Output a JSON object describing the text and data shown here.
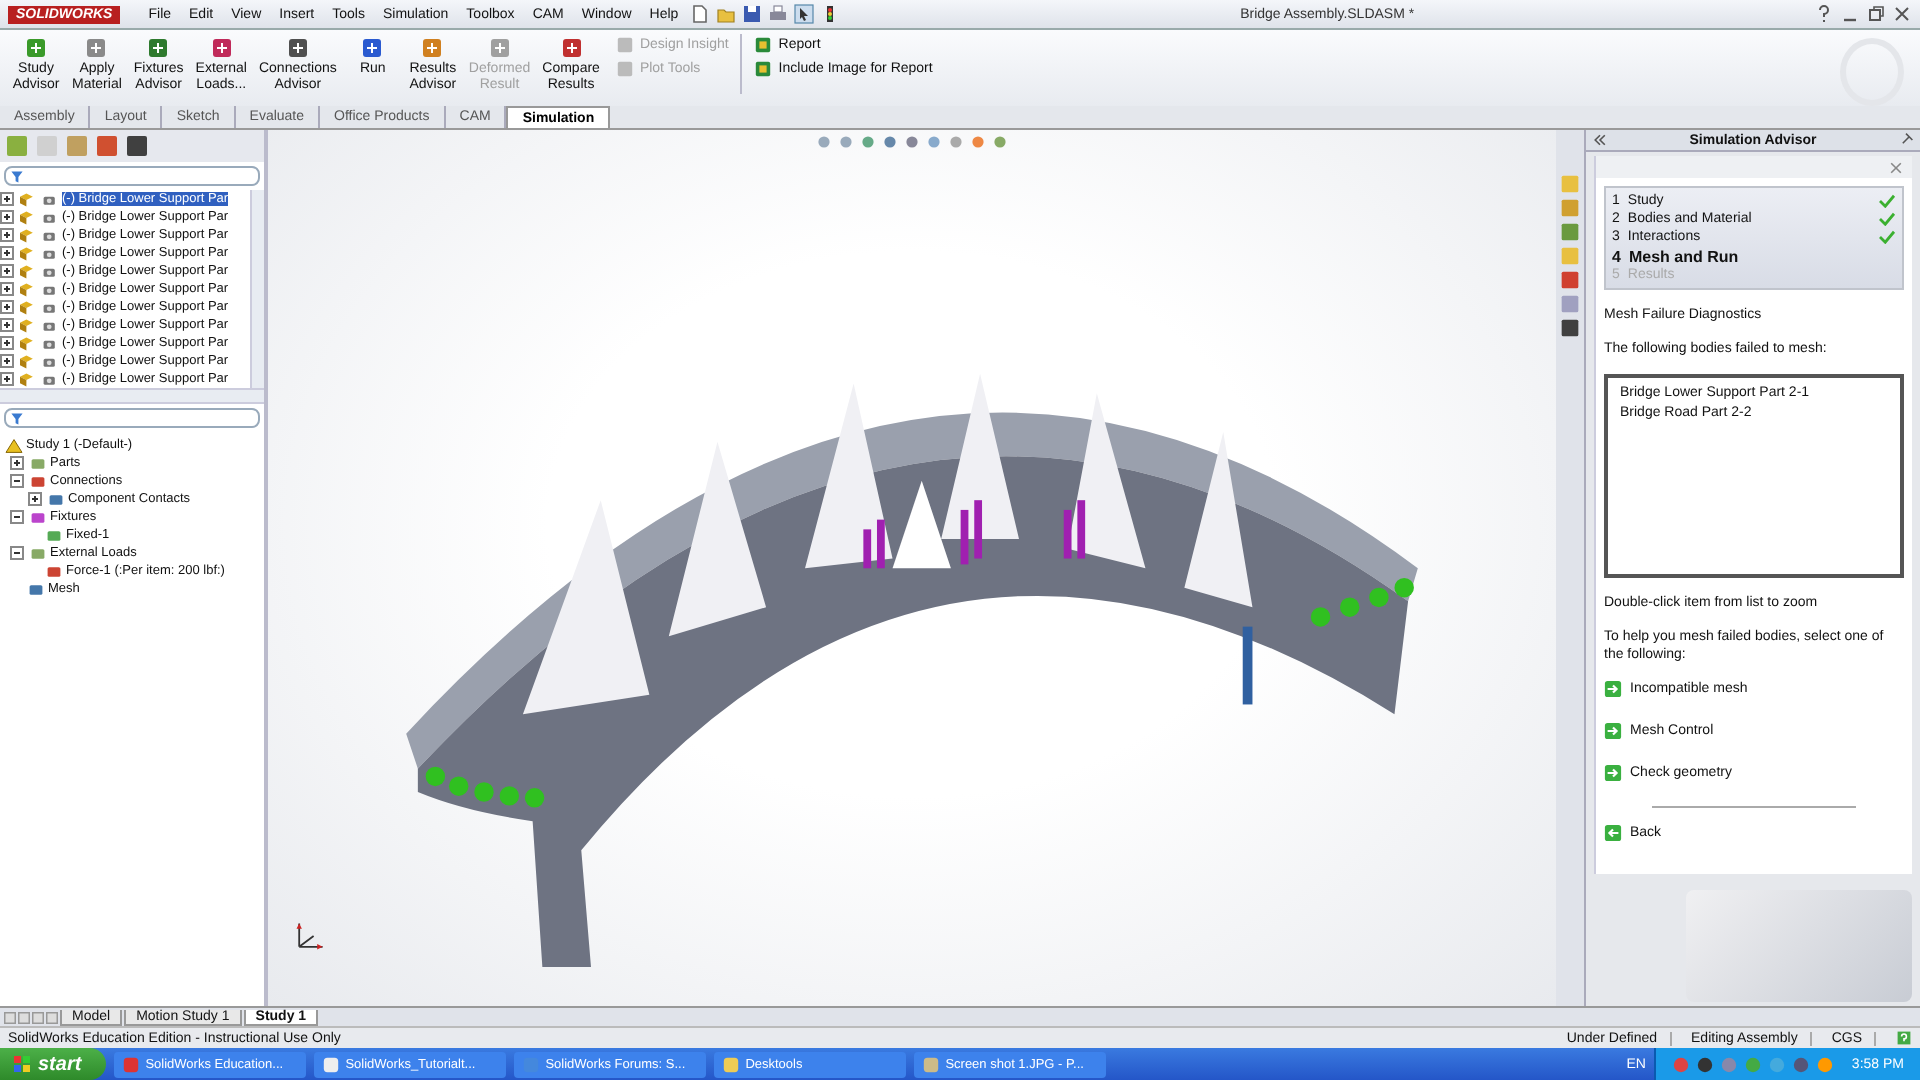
{
  "app": {
    "logo": "SOLIDWORKS",
    "title": "Bridge Assembly.SLDASM *"
  },
  "menus": [
    "File",
    "Edit",
    "View",
    "Insert",
    "Tools",
    "Simulation",
    "Toolbox",
    "CAM",
    "Window",
    "Help"
  ],
  "ribbon": {
    "tools": [
      {
        "label": "Study Advisor",
        "disabled": false,
        "color": "#3a9a2a"
      },
      {
        "label": "Apply Material",
        "disabled": false,
        "color": "#8a8a8a"
      },
      {
        "label": "Fixtures Advisor",
        "disabled": false,
        "color": "#2e7a2e"
      },
      {
        "label": "External Loads...",
        "disabled": false,
        "color": "#c02a5a"
      },
      {
        "label": "Connections Advisor",
        "disabled": false,
        "color": "#505050"
      },
      {
        "label": "Run",
        "disabled": false,
        "color": "#2a5ad0"
      },
      {
        "label": "Results Advisor",
        "disabled": false,
        "color": "#d08020"
      },
      {
        "label": "Deformed Result",
        "disabled": true,
        "color": "#a0a0a0"
      },
      {
        "label": "Compare Results",
        "disabled": false,
        "color": "#c03030"
      }
    ],
    "small_tools": [
      {
        "label": "Design Insight",
        "disabled": true
      },
      {
        "label": "Plot Tools",
        "disabled": true
      }
    ],
    "report_tools": [
      {
        "label": "Report"
      },
      {
        "label": "Include Image for Report"
      }
    ]
  },
  "tabs": [
    {
      "label": "Assembly",
      "selected": false
    },
    {
      "label": "Layout",
      "selected": false
    },
    {
      "label": "Sketch",
      "selected": false
    },
    {
      "label": "Evaluate",
      "selected": false
    },
    {
      "label": "Office Products",
      "selected": false
    },
    {
      "label": "CAM",
      "selected": false
    },
    {
      "label": "Simulation",
      "selected": true
    }
  ],
  "feature_tree": {
    "items": [
      {
        "label": "(-) Bridge Lower Support Par",
        "selected": true
      },
      {
        "label": "(-) Bridge Lower Support Par",
        "selected": false
      },
      {
        "label": "(-) Bridge Lower Support Par",
        "selected": false
      },
      {
        "label": "(-) Bridge Lower Support Par",
        "selected": false
      },
      {
        "label": "(-) Bridge Lower Support Par",
        "selected": false
      },
      {
        "label": "(-) Bridge Lower Support Par",
        "selected": false
      },
      {
        "label": "(-) Bridge Lower Support Par",
        "selected": false
      },
      {
        "label": "(-) Bridge Lower Support Par",
        "selected": false
      },
      {
        "label": "(-) Bridge Lower Support Par",
        "selected": false
      },
      {
        "label": "(-) Bridge Lower Support Par",
        "selected": false
      },
      {
        "label": "(-) Bridge Lower Support Par",
        "selected": false
      }
    ]
  },
  "study_tree": {
    "label": "Study 1 (-Default-)",
    "children": [
      {
        "label": "Parts",
        "expanded": false
      },
      {
        "label": "Connections",
        "expanded": true,
        "children": [
          {
            "label": "Component Contacts",
            "expanded": false
          }
        ]
      },
      {
        "label": "Fixtures",
        "expanded": true,
        "children": [
          {
            "label": "Fixed-1"
          }
        ]
      },
      {
        "label": "External Loads",
        "expanded": true,
        "children": [
          {
            "label": "Force-1 (:Per item: 200 lbf:)"
          }
        ]
      },
      {
        "label": "Mesh"
      }
    ]
  },
  "advisor": {
    "title": "Simulation Advisor",
    "steps": [
      {
        "number": "1",
        "label": "Study",
        "done": true,
        "current": false,
        "disabled": false
      },
      {
        "number": "2",
        "label": "Bodies and Material",
        "done": true,
        "current": false,
        "disabled": false
      },
      {
        "number": "3",
        "label": "Interactions",
        "done": true,
        "current": false,
        "disabled": false
      },
      {
        "number": "4",
        "label": "Mesh and Run",
        "done": false,
        "current": true,
        "disabled": false
      },
      {
        "number": "5",
        "label": "Results",
        "done": false,
        "current": false,
        "disabled": true
      }
    ],
    "heading": "Mesh Failure Diagnostics",
    "intro": "The following bodies failed to mesh:",
    "failed_bodies": [
      "Bridge Lower Support Part 2-1",
      "Bridge Road Part 2-2"
    ],
    "hint": "Double-click item from list to zoom",
    "help": "To help you mesh failed bodies, select one of the following:",
    "links": [
      {
        "label": "Incompatible mesh",
        "kind": "forward"
      },
      {
        "label": "Mesh Control",
        "kind": "forward"
      },
      {
        "label": "Check geometry",
        "kind": "forward"
      },
      {
        "label": "Back",
        "kind": "back"
      }
    ]
  },
  "bottom_tabs": [
    {
      "label": "Model",
      "selected": false
    },
    {
      "label": "Motion Study 1",
      "selected": false
    },
    {
      "label": "Study 1",
      "selected": true
    }
  ],
  "status_bar": {
    "message": "SolidWorks Education Edition - Instructional Use Only",
    "fields": [
      "Under Defined",
      "Editing Assembly",
      "CGS"
    ]
  },
  "taskbar": {
    "start": "start",
    "tasks": [
      "SolidWorks Education...",
      "SolidWorks_Tutorialt...",
      "SolidWorks Forums: S...",
      "Desktools",
      "Screen shot 1.JPG - P..."
    ],
    "language": "EN",
    "clock": "3:58 PM"
  }
}
